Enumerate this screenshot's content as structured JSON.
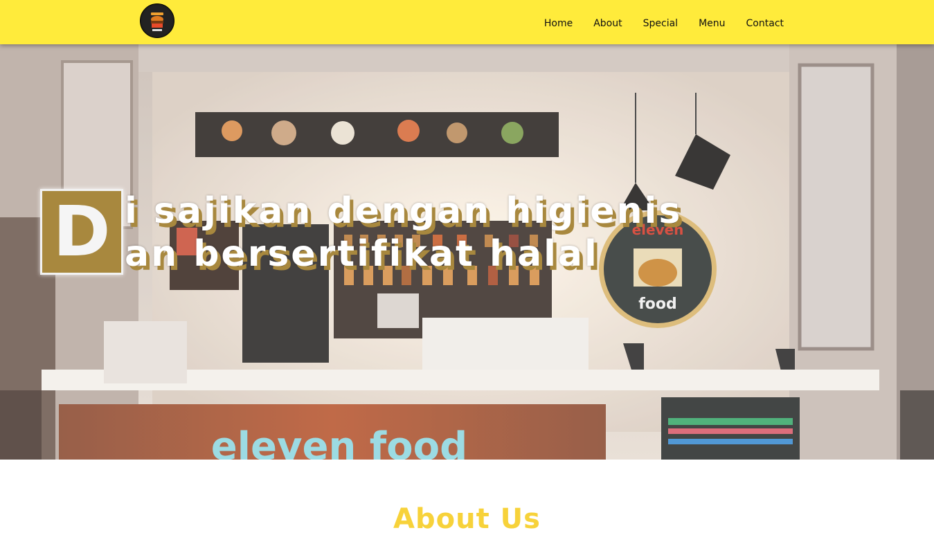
{
  "nav": {
    "logo_alt": "eleven food",
    "items": [
      {
        "label": "Home"
      },
      {
        "label": "About"
      },
      {
        "label": "Special"
      },
      {
        "label": "Menu"
      },
      {
        "label": "Contact"
      }
    ]
  },
  "hero": {
    "dropcap": "D",
    "line1": "i sajikan dengan higienis",
    "line2": "an bersertifikat halal",
    "sign_top": "eleven",
    "sign_bottom": "food",
    "counter_text": "eleven food"
  },
  "about": {
    "title": "About Us"
  },
  "colors": {
    "navbar": "#ffeb3b",
    "accent_gold": "#a8883e",
    "about_title": "#f7d23a"
  }
}
